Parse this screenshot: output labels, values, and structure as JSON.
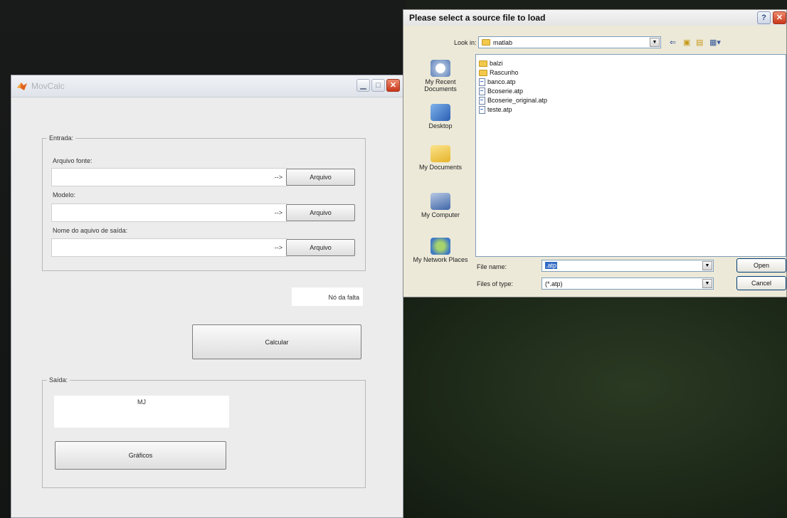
{
  "movcalc": {
    "title": "MovCalc",
    "entrada": {
      "legend": "Entrada:",
      "arquivo_fonte_label": "Arquivo fonte:",
      "modelo_label": "Modelo:",
      "nome_saida_label": "Nome do aquivo de saída:",
      "arrow": "-->",
      "arquivo_button": "Arquivo"
    },
    "no_da_falta": "Nó da falta",
    "calcular_button": "Calcular",
    "saida": {
      "legend": "Saída:",
      "output_text": "MJ",
      "graficos_button": "Gráficos"
    }
  },
  "dialog": {
    "title": "Please select a source file to load",
    "look_in_label": "Look in:",
    "look_in_value": "matlab",
    "places": [
      "My Recent Documents",
      "Desktop",
      "My Documents",
      "My Computer",
      "My Network Places"
    ],
    "files": [
      {
        "name": "balzi",
        "type": "folder"
      },
      {
        "name": "Rascunho",
        "type": "folder"
      },
      {
        "name": "banco.atp",
        "type": "file"
      },
      {
        "name": "Bcoserie.atp",
        "type": "file"
      },
      {
        "name": "Bcoserie_original.atp",
        "type": "file"
      },
      {
        "name": "teste.atp",
        "type": "file"
      }
    ],
    "file_name_label": "File name:",
    "file_name_value": ".atp",
    "files_of_type_label": "Files of type:",
    "files_of_type_value": "(*.atp)",
    "open_button": "Open",
    "cancel_button": "Cancel"
  },
  "colors": {
    "desktop_left": "#171918",
    "desktop_right": "#2b3a23",
    "window_bg": "#ececec",
    "dialog_bg": "#ece9d8"
  }
}
